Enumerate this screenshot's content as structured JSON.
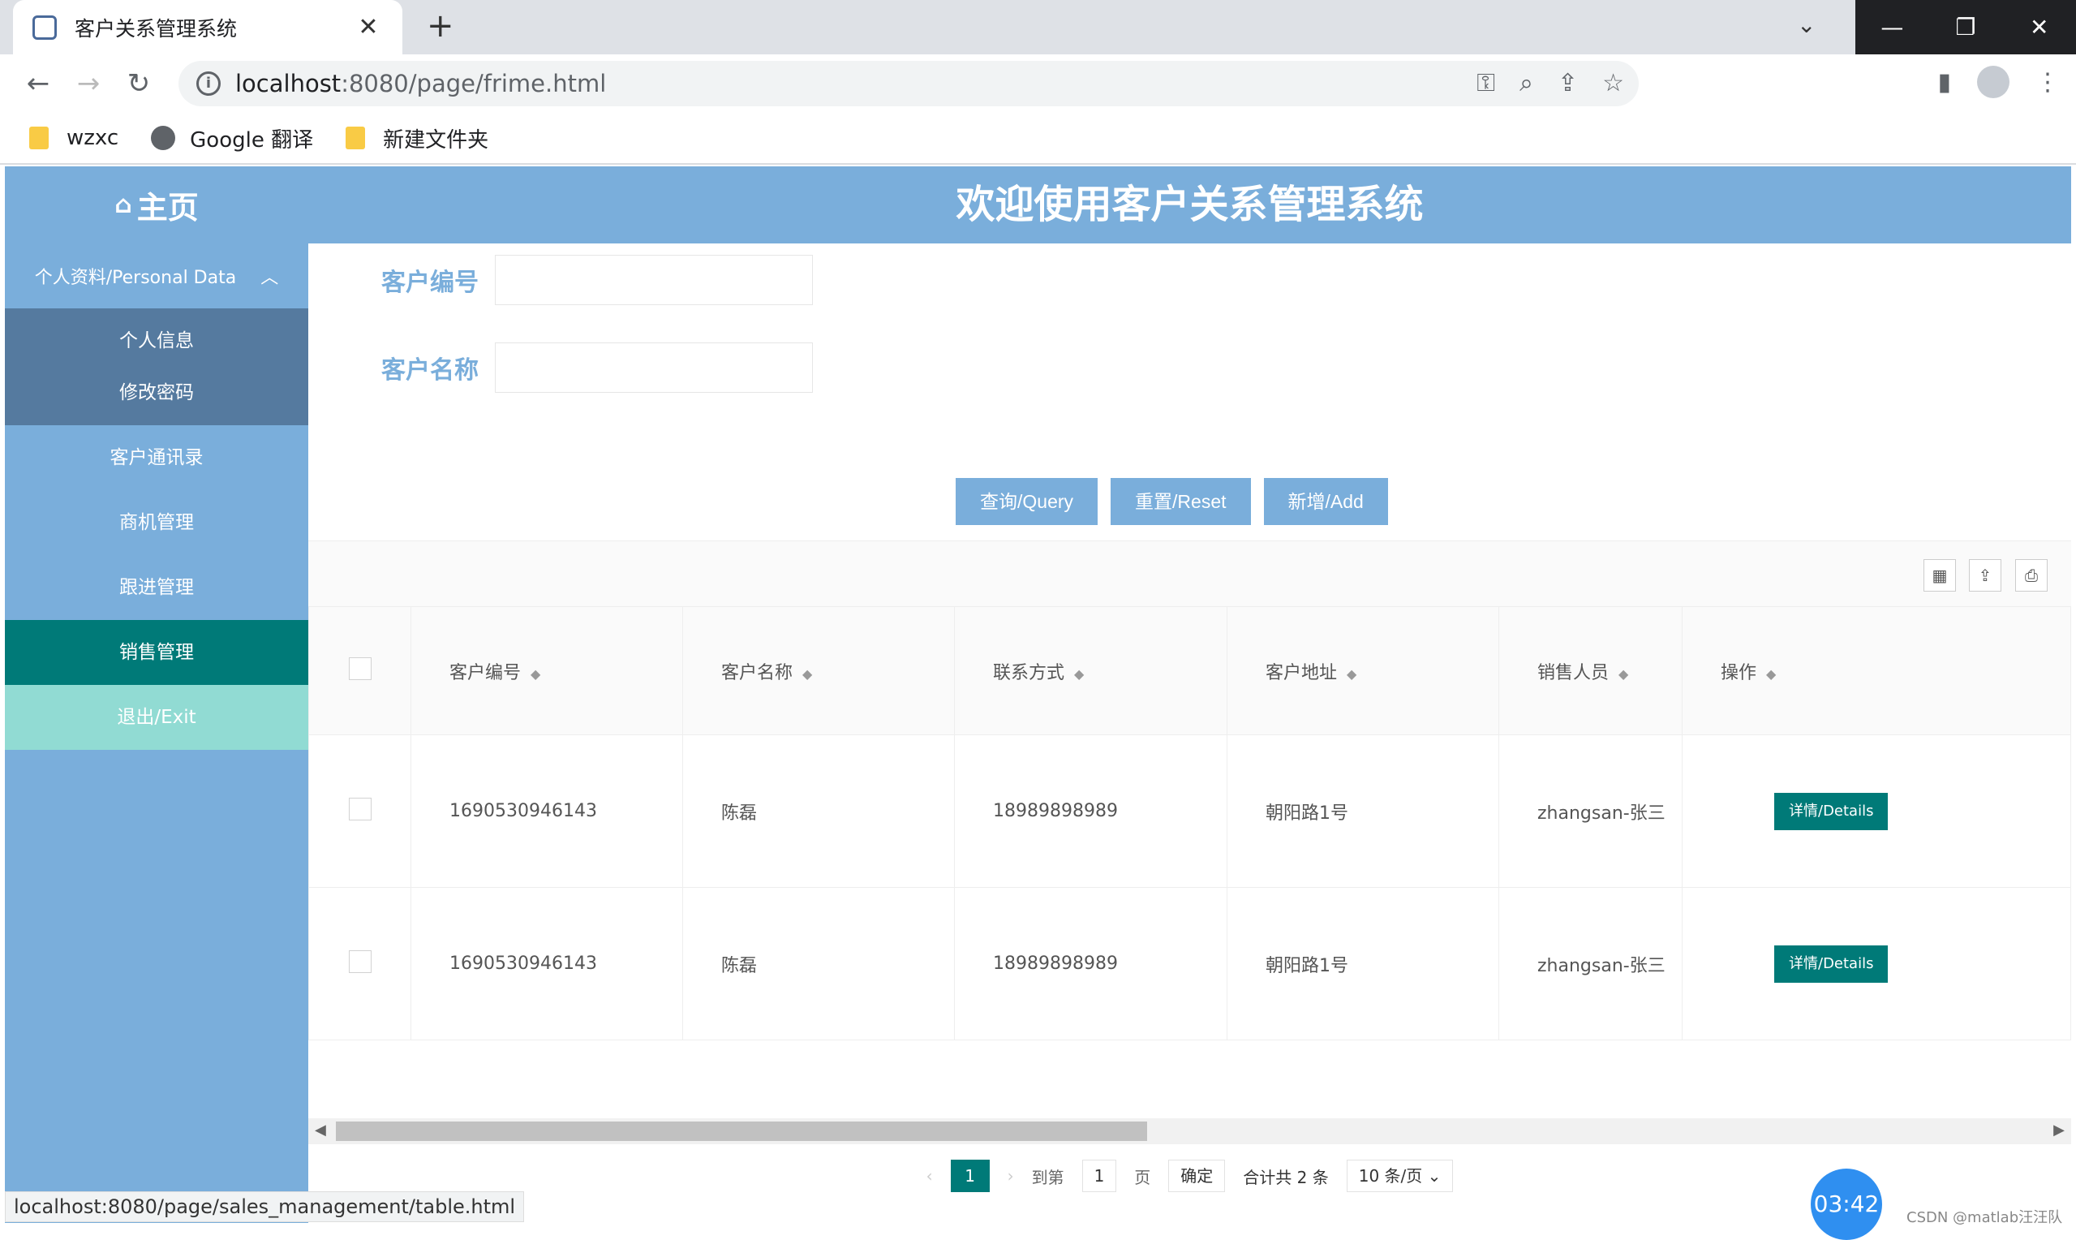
{
  "browser": {
    "tab_title": "客户关系管理系统",
    "tab_close": "✕",
    "new_tab": "+",
    "url_host": "localhost",
    "url_path": ":8080/page/frime.html",
    "bookmarks": [
      "wzxc",
      "Google 翻译",
      "新建文件夹"
    ],
    "status_url": "localhost:8080/page/sales_management/table.html"
  },
  "header": {
    "home_label": "主页",
    "title": "欢迎使用客户关系管理系统"
  },
  "sidebar": {
    "group_label": "个人资料/Personal Data",
    "sub_items": [
      "个人信息",
      "修改密码"
    ],
    "items": [
      "客户通讯录",
      "商机管理",
      "跟进管理",
      "销售管理"
    ],
    "exit_label": "退出/Exit",
    "active_item": "销售管理"
  },
  "search": {
    "field1_label": "客户编号",
    "field2_label": "客户名称",
    "query_label": "查询/Query",
    "reset_label": "重置/Reset",
    "add_label": "新增/Add"
  },
  "table": {
    "columns": [
      "客户编号",
      "客户名称",
      "联系方式",
      "客户地址",
      "销售人员",
      "操作"
    ],
    "rows": [
      [
        "1690530946143",
        "陈磊",
        "18989898989",
        "朝阳路1号",
        "zhangsan-张三"
      ],
      [
        "1690530946143",
        "陈磊",
        "18989898989",
        "朝阳路1号",
        "zhangsan-张三"
      ]
    ],
    "detail_label": "详情/Details"
  },
  "pager": {
    "current": "1",
    "goto_label": "到第",
    "goto_value": "1",
    "page_unit": "页",
    "confirm_label": "确定",
    "total_label": "合计共 2 条",
    "page_size": "10 条/页"
  },
  "overlay": {
    "timer": "03:42",
    "watermark": "CSDN @matlab汪汪队"
  },
  "colors": {
    "header_blue": "#7aaedb",
    "active_teal": "#007a78",
    "exit_mint": "#91dbd3"
  }
}
